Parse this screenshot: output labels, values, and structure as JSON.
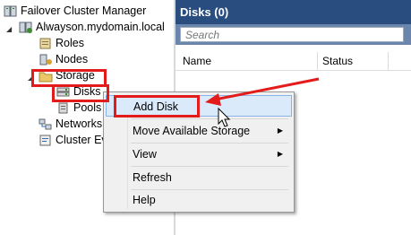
{
  "tree": {
    "root_label": "Failover Cluster Manager",
    "cluster_label": "Alwayson.mydomain.local",
    "items": {
      "roles": "Roles",
      "nodes": "Nodes",
      "storage": "Storage",
      "disks": "Disks",
      "pools": "Pools",
      "networks": "Networks",
      "cluster_events": "Cluster Events"
    }
  },
  "pane": {
    "title": "Disks (0)",
    "search_placeholder": "Search",
    "columns": [
      "Name",
      "Status"
    ]
  },
  "context_menu": {
    "items": [
      "Add Disk",
      "Move Available Storage",
      "View",
      "Refresh",
      "Help"
    ]
  },
  "colors": {
    "highlight": "#e31b1b",
    "header": "#2a4d7f"
  }
}
